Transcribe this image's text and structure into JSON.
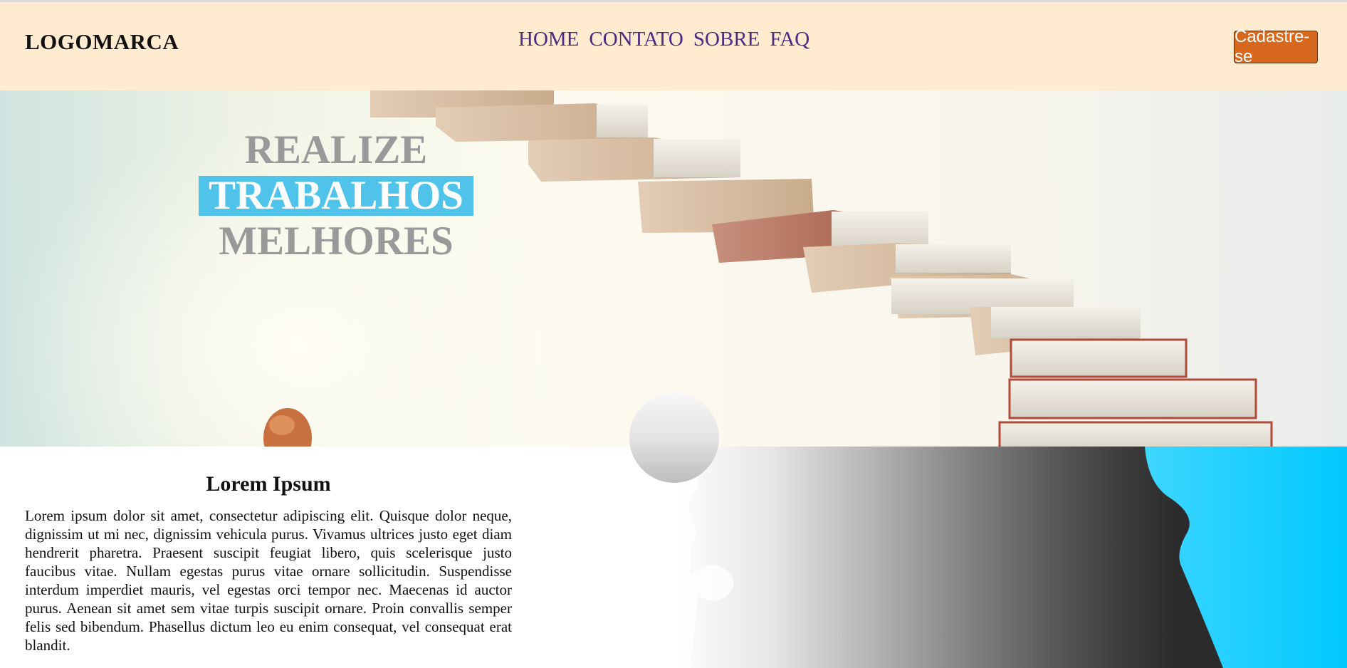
{
  "header": {
    "logo": "LOGOMARCA",
    "nav": [
      {
        "label": "HOME"
      },
      {
        "label": "CONTATO"
      },
      {
        "label": "SOBRE"
      },
      {
        "label": "FAQ"
      }
    ],
    "signup_label": "Cadastre-se"
  },
  "hero": {
    "line1": "REALIZE",
    "line2": "TRABALHOS",
    "line3": "MELHORES",
    "image": "books-staircase-illustration"
  },
  "section": {
    "title": "Lorem Ipsum",
    "body": "Lorem ipsum dolor sit amet, consectetur adipiscing elit. Quisque dolor neque, dignissim ut mi nec, dignissim vehicula purus. Vivamus ultrices justo eget diam hendrerit pharetra. Praesent suscipit feugiat libero, quis scelerisque justo faucibus vitae. Nullam egestas purus vitae ornare sollicitudin. Suspendisse interdum imperdiet mauris, vel egestas orci tempor nec. Maecenas id auctor purus. Aenean sit amet sem vitae turpis suscipit ornare. Proin convallis semper felis sed bibendum. Phasellus dictum leo eu enim consequat, vel consequat erat blandit.",
    "image": "puzzle-gradient-image"
  },
  "colors": {
    "header_bg": "#ffebcf",
    "nav_link": "#4b2a84",
    "button_bg": "#d8681e",
    "highlight": "#4fc3ea",
    "cyan": "#00cfff"
  }
}
